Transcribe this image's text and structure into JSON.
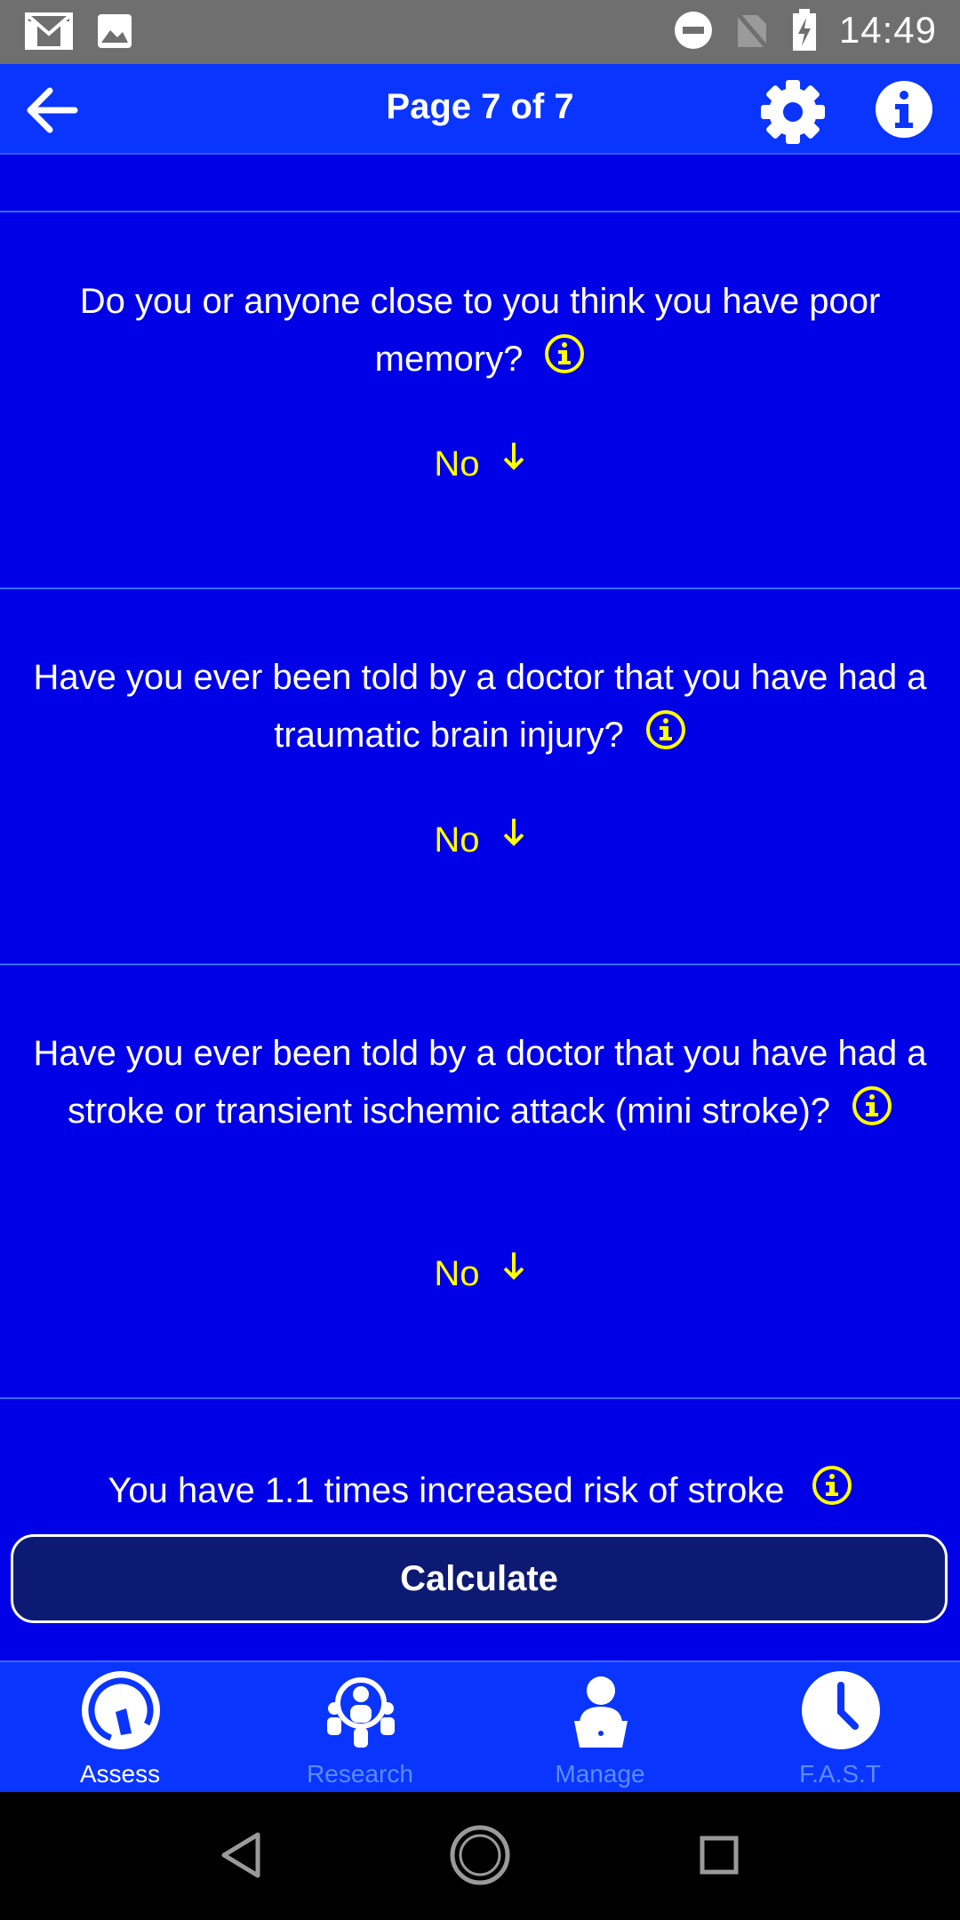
{
  "status_bar": {
    "time": "14:49"
  },
  "app_bar": {
    "title": "Page 7 of 7"
  },
  "questions": [
    {
      "text": "Do you or anyone close to you think you have poor memory?",
      "answer": "No"
    },
    {
      "text": "Have you ever been told by a doctor that you have had a traumatic brain injury?",
      "answer": "No"
    },
    {
      "text": "Have you ever been told by a doctor that you have had a stroke or transient ischemic attack (mini stroke)?",
      "answer": "No"
    }
  ],
  "result": {
    "text": "You have 1.1 times increased risk of stroke"
  },
  "calculate_label": "Calculate",
  "bottom_nav": [
    {
      "label": "Assess",
      "active": true
    },
    {
      "label": "Research",
      "active": false
    },
    {
      "label": "Manage",
      "active": false
    },
    {
      "label": "F.A.S.T",
      "active": false
    }
  ],
  "colors": {
    "background": "#0000e6",
    "app_bar": "#0a35ff",
    "answer": "#ffff00",
    "button": "#0d1a73"
  }
}
